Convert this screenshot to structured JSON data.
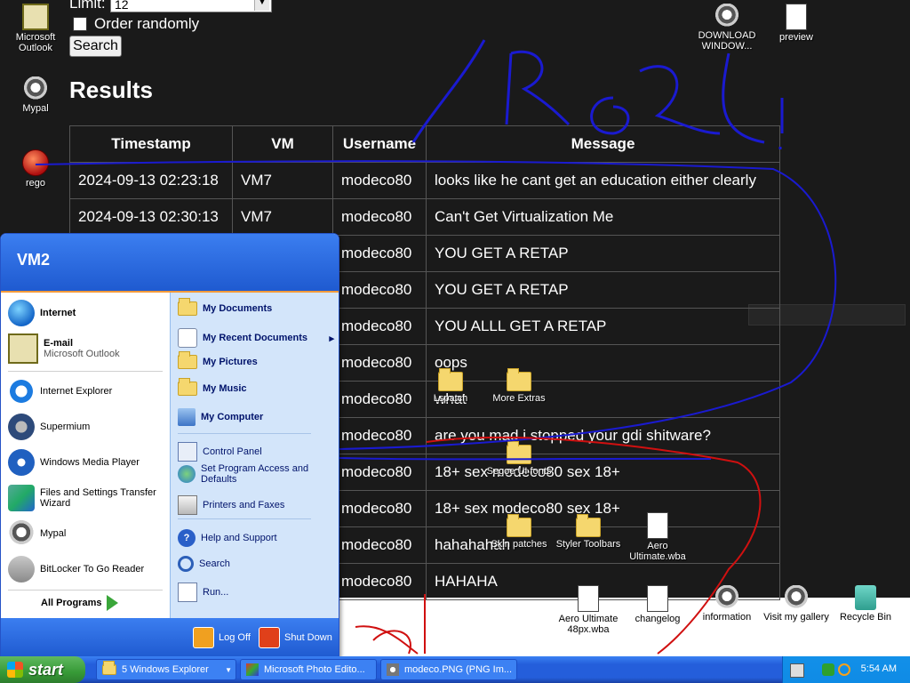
{
  "form": {
    "limit_label": "Limit:",
    "limit_value": "12",
    "order_label": "Order randomly",
    "search_label": "Search"
  },
  "results": {
    "title": "Results",
    "columns": [
      "Timestamp",
      "VM",
      "Username",
      "Message"
    ],
    "rows": [
      [
        "2024-09-13 02:23:18",
        "VM7",
        "modeco80",
        "looks like he cant get an education either clearly"
      ],
      [
        "2024-09-13 02:30:13",
        "VM7",
        "modeco80",
        "Can't Get Virtualization Me"
      ],
      [
        "",
        "",
        "modeco80",
        "YOU GET A RETAP"
      ],
      [
        "",
        "",
        "modeco80",
        "YOU GET A RETAP"
      ],
      [
        "",
        "",
        "modeco80",
        "YOU ALLL GET A RETAP"
      ],
      [
        "",
        "",
        "modeco80",
        "oops"
      ],
      [
        "",
        "",
        "modeco80",
        "what"
      ],
      [
        "",
        "",
        "modeco80",
        "are you mad i stopped your gdi shitware?"
      ],
      [
        "",
        "",
        "modeco80",
        "18+ sex modeco80 sex 18+"
      ],
      [
        "",
        "",
        "modeco80",
        "18+ sex modeco80 sex 18+"
      ],
      [
        "",
        "",
        "modeco80",
        "hahahahah"
      ],
      [
        "",
        "",
        "modeco80",
        "HAHAHA"
      ]
    ]
  },
  "desktop_icons": {
    "outlook": "Microsoft Outlook",
    "mypal": "Mypal",
    "rego": "rego",
    "download": "DOWNLOAD WINDOW...",
    "preview": "preview",
    "lspatch": "Lspatch",
    "more_extras": "More Extras",
    "segoe": "Segoe UI fonts",
    "skin_patches": "Skin patches",
    "styler": "Styler Toolbars",
    "aero_wba": "Aero Ultimate.wba",
    "aero48": "Aero Ultimate 48px.wba",
    "changelog": "changelog",
    "information": "information",
    "visit_gallery": "Visit my gallery",
    "recycle": "Recycle Bin"
  },
  "start_menu": {
    "user": "VM2",
    "left": {
      "internet": "Internet",
      "email": "E-mail",
      "email_sub": "Microsoft Outlook",
      "ie": "Internet Explorer",
      "supermium": "Supermium",
      "wmp": "Windows Media Player",
      "fast": "Files and Settings Transfer Wizard",
      "mypal": "Mypal",
      "bitlocker": "BitLocker To Go Reader",
      "all_programs": "All Programs"
    },
    "right": {
      "my_documents": "My Documents",
      "recent": "My Recent Documents",
      "pictures": "My Pictures",
      "music": "My Music",
      "computer": "My Computer",
      "control_panel": "Control Panel",
      "spad": "Set Program Access and Defaults",
      "printers": "Printers and Faxes",
      "help": "Help and Support",
      "search": "Search",
      "run": "Run..."
    },
    "log_off": "Log Off",
    "shut_down": "Shut Down"
  },
  "taskbar": {
    "start": "start",
    "tasks": [
      "5 Windows Explorer",
      "Microsoft Photo Edito...",
      "modeco.PNG (PNG Im..."
    ],
    "clock": "5:54 AM"
  },
  "colors": {
    "page_bg": "#1a1a1a",
    "xp_blue": "#245edb",
    "start_green": "#379a37",
    "annotation_blue": "#1a1ad0",
    "annotation_red": "#d01010"
  }
}
